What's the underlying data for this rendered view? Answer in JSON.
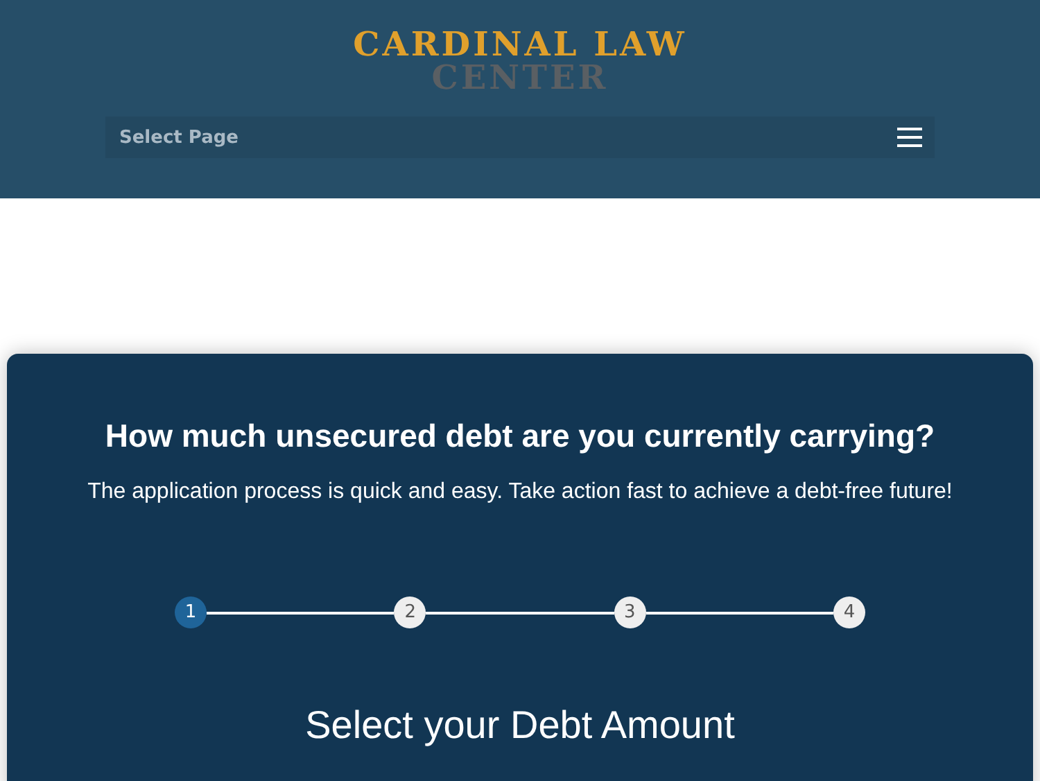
{
  "header": {
    "logo": {
      "line_1": "CARDINAL LAW",
      "line_2": "CENTER"
    },
    "menu": {
      "label": "Select Page"
    }
  },
  "form": {
    "title": "How much unsecured debt are you currently carrying?",
    "subtitle": "The application process is quick and easy. Take action fast to achieve a debt-free future!",
    "steps": [
      {
        "label": "1",
        "selected": true
      },
      {
        "label": "2",
        "selected": false
      },
      {
        "label": "3",
        "selected": false
      },
      {
        "label": "4",
        "selected": false
      }
    ],
    "section_heading": "Select your Debt Amount"
  }
}
